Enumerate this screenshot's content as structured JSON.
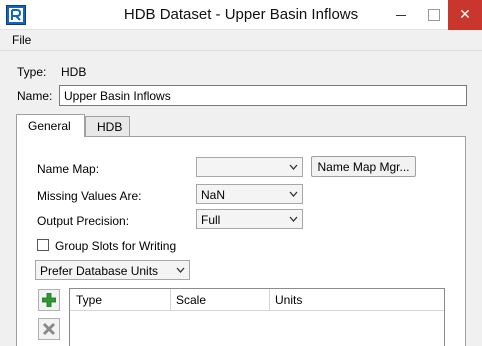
{
  "window": {
    "title": "HDB Dataset - Upper Basin Inflows",
    "close_glyph": "✕"
  },
  "menu": {
    "file": "File"
  },
  "dataset": {
    "type_label": "Type:",
    "type_value": "HDB",
    "name_label": "Name:",
    "name_value": "Upper Basin Inflows"
  },
  "tabs": {
    "general": "General",
    "hdb": "HDB"
  },
  "general": {
    "name_map_label": "Name Map:",
    "name_map_value": "",
    "name_map_mgr_button": "Name Map Mgr...",
    "missing_values_label": "Missing Values Are:",
    "missing_values_value": "NaN",
    "output_precision_label": "Output Precision:",
    "output_precision_value": "Full",
    "group_slots_label": "Group Slots for Writing",
    "group_slots_checked": false,
    "units_preference_value": "Prefer Database Units"
  },
  "units_table": {
    "columns": [
      "Type",
      "Scale",
      "Units"
    ],
    "rows": []
  },
  "icons": {
    "app": "riverware-app-icon",
    "add": "add-plus-icon",
    "delete": "delete-x-icon",
    "dropdown": "chevron-down-icon"
  },
  "colors": {
    "close_button": "#c8362d",
    "add_icon": "#2e9b2e",
    "app_icon": "#1565c0"
  }
}
